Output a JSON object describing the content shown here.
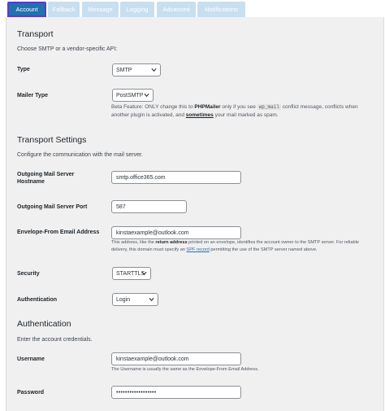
{
  "tabs": [
    {
      "label": "Account",
      "active": true
    },
    {
      "label": "Fallback",
      "active": false
    },
    {
      "label": "Message",
      "active": false
    },
    {
      "label": "Logging",
      "active": false
    },
    {
      "label": "Advanced",
      "active": false
    },
    {
      "label": "Notifications",
      "active": false
    }
  ],
  "transport": {
    "heading": "Transport",
    "description": "Choose SMTP or a vendor-specific API:",
    "type_label": "Type",
    "type_value": "SMTP",
    "mailer_label": "Mailer Type",
    "mailer_value": "PostSMTP",
    "mailer_note": {
      "p1": "Beta Feature: ONLY change this to ",
      "p2": "PHPMailer",
      "p3": " only if you see ",
      "p4": "wp_mail",
      "p5": " conflict message, conflicts when another plugin is activated, and ",
      "p6": "sometimes",
      "p7": " your mail marked as spam."
    }
  },
  "settings": {
    "heading": "Transport Settings",
    "description": "Configure the communication with the mail server.",
    "server_label_1": "Outgoing Mail Server",
    "server_label_2": "Hostname",
    "server_value": "smtp.office365.com",
    "port_label": "Outgoing Mail Server Port",
    "port_value": "587",
    "envelope_label": "Envelope-From Email Address",
    "envelope_value": "kinstaexample@outlook.com",
    "envelope_note": {
      "p1": "This address, like the ",
      "p2": "return address",
      "p3": " printed on an envelope, identifies the account owner to the SMTP server. For reliable",
      "p4": "delivery, this domain must specify an ",
      "p5": "SPF record",
      "p6": " permitting the use of the SMTP server named above."
    },
    "security_label": "Security",
    "security_value": "STARTTLS",
    "auth_label": "Authentication",
    "auth_value": "Login"
  },
  "authentication": {
    "heading": "Authentication",
    "description": "Enter the account credentials.",
    "username_label": "Username",
    "username_value": "kinstaexample@outlook.com",
    "username_note": "The Username is usually the same as the Envelope-From Email Address.",
    "password_label": "Password",
    "password_value": "••••••••••••••••••"
  },
  "colors": {
    "accent": "#2271b1",
    "active_tab_outline": "#5b3cc4",
    "inactive_tab": "#c8dff0",
    "panel_bg": "#f0f0f1"
  }
}
